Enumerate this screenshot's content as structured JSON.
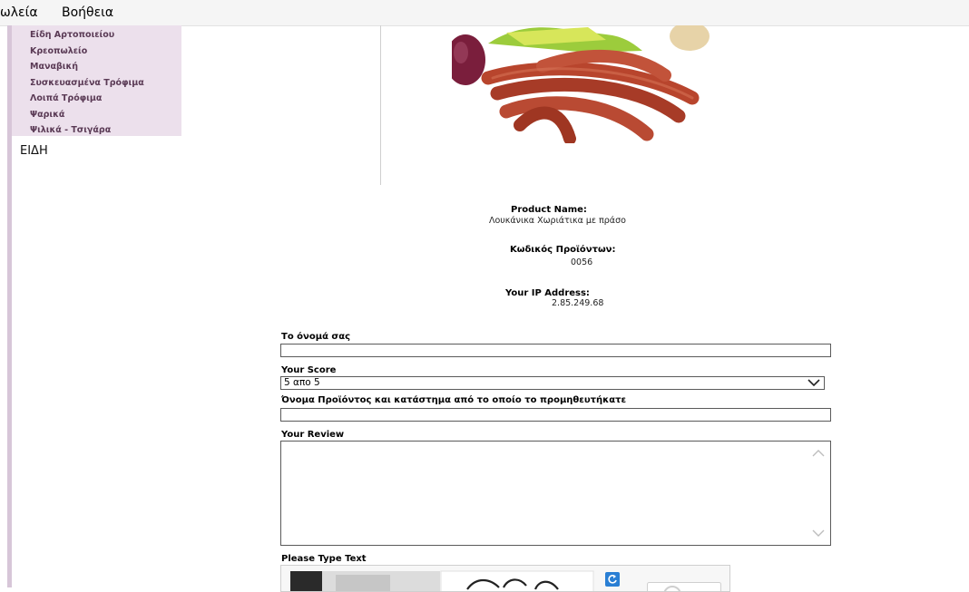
{
  "menu": {
    "items": [
      "ωλεία",
      "Βοήθεια"
    ]
  },
  "sidebar": {
    "categories": [
      "Είδη Αρτοποιείου",
      "Κρεοπωλείο",
      "Μαναβική",
      "Συσκευασμένα Τρόφιμα",
      "Λοιπά Τρόφιμα",
      "Ψαρικά",
      "Ψιλικά - Τσιγάρα"
    ],
    "heading": "ΕΙΔΗ"
  },
  "product": {
    "image_icon": "sausages-photo",
    "name_label": "Product Name:",
    "name_value": "Λουκάνικα Χωριάτικα με πράσο",
    "code_label": "Κωδικός Προϊόντων:",
    "code_value": "0056",
    "ip_label": "Your IP Address:",
    "ip_value": "2.85.249.68"
  },
  "form": {
    "name_label": "Το όνομά σας",
    "name_value": "",
    "score_label": "Your Score",
    "score_value": "5 απο 5",
    "store_label": "Όνομα Προϊόντος και κατάστημα από το οποίο το προμηθευτήκατε",
    "store_value": "",
    "review_label": "Your Review",
    "review_value": "",
    "captcha_label": "Please Type Text"
  },
  "colors": {
    "sidebar_bg": "#ece0ec",
    "sidebar_text": "#5a3a55",
    "accent_blue": "#2a7fd4"
  }
}
